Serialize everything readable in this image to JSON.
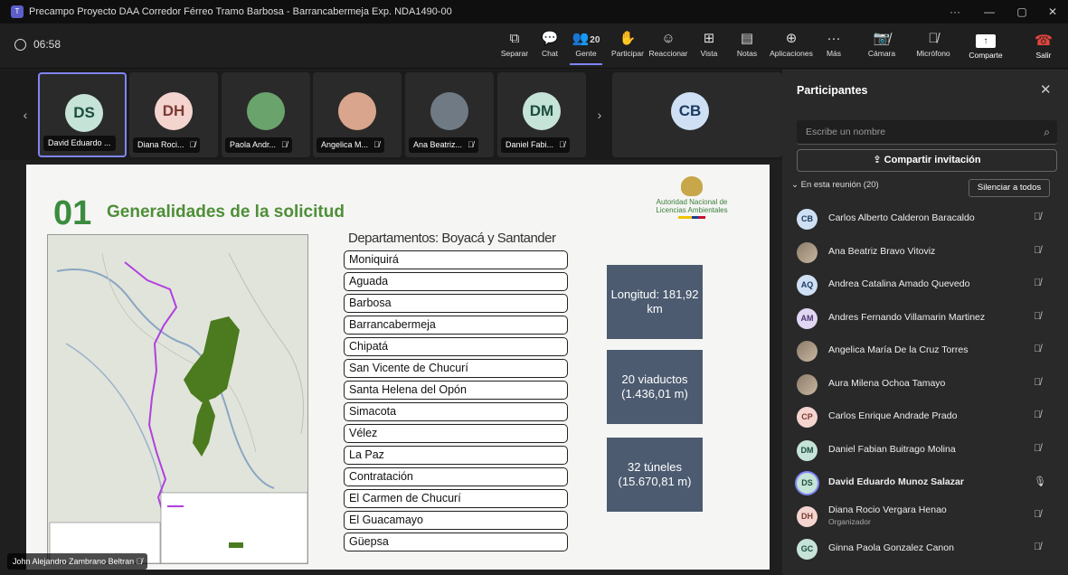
{
  "window": {
    "title": "Precampo Proyecto DAA Corredor Férreo Tramo Barbosa - Barrancabermeja Exp. NDA1490-00",
    "controls": [
      "···",
      "—",
      "▢",
      "✕"
    ]
  },
  "toolbar": {
    "timer": "06:58",
    "buttons": [
      {
        "id": "separar",
        "label": "Separar",
        "icon": "⧉"
      },
      {
        "id": "chat",
        "label": "Chat",
        "icon": "💬"
      },
      {
        "id": "gente",
        "label": "Gente",
        "icon": "👥",
        "count": "20"
      },
      {
        "id": "participar",
        "label": "Participar",
        "icon": "✋"
      },
      {
        "id": "reaccionar",
        "label": "Reaccionar",
        "icon": "☺"
      },
      {
        "id": "vista",
        "label": "Vista",
        "icon": "⊞"
      },
      {
        "id": "notas",
        "label": "Notas",
        "icon": "▤"
      },
      {
        "id": "aplicaciones",
        "label": "Aplicaciones",
        "icon": "⊕"
      },
      {
        "id": "mas",
        "label": "Más",
        "icon": "···"
      },
      {
        "id": "camara",
        "label": "Cámara",
        "icon": "📷̸"
      },
      {
        "id": "microfono",
        "label": "Micrófono",
        "icon": "🎙̸"
      }
    ],
    "compartir_label": "Comparte",
    "salir_label": "Salir"
  },
  "video_strip": [
    {
      "initials": "DS",
      "name": "David Eduardo ...",
      "color": "#c6e3d8",
      "text_color": "#1b4d3e",
      "muted": false
    },
    {
      "initials": "DH",
      "name": "Diana Roci...",
      "color": "#f4d4cf",
      "text_color": "#7a3b32",
      "muted": true
    },
    {
      "initials": "",
      "name": "Paola Andr...",
      "color": "#6aa36b",
      "text_color": "#fff",
      "muted": true
    },
    {
      "initials": "",
      "name": "Angelica M...",
      "color": "#d9a58d",
      "text_color": "#fff",
      "muted": true
    },
    {
      "initials": "",
      "name": "Ana Beatriz...",
      "color": "#6f7a84",
      "text_color": "#fff",
      "muted": true
    },
    {
      "initials": "DM",
      "name": "Daniel Fabi...",
      "color": "#c6e3d8",
      "text_color": "#1b4d3e",
      "muted": true
    },
    {
      "initials": "",
      "name": "",
      "color": "#2a2a2a",
      "text_color": "#fff",
      "muted": true
    },
    {
      "initials": "CB",
      "name": "",
      "color": "#cfe0f4",
      "text_color": "#1c3a60",
      "muted": false
    }
  ],
  "slide": {
    "number": "01",
    "title": "Generalidades de la solicitud",
    "logo_text": "Autoridad Nacional de Licencias Ambientales",
    "departments_header": "Departamentos: Boyacá y Santander",
    "municipalities": [
      "Moniquirá",
      "Aguada",
      "Barbosa",
      "Barrancabermeja",
      "Chipatá",
      "San Vicente de Chucurí",
      "Santa Helena del Opón",
      "Simacota",
      "Vélez",
      "La Paz",
      "Contratación",
      "El Carmen de Chucurí",
      "El Guacamayo",
      "Güepsa"
    ],
    "info_boxes": [
      "Longitud: 181,92 km",
      "20 viaductos (1.436,01 m)",
      "32 túneles (15.670,81 m)"
    ]
  },
  "presenter_label": "John Alejandro Zambrano Beltran",
  "panel": {
    "title": "Participantes",
    "search_placeholder": "Escribe un nombre",
    "invite_label": "Compartir invitación",
    "section_label": "En esta reunión (20)",
    "mute_all_label": "Silenciar a todos",
    "participants": [
      {
        "initials": "CB",
        "name": "Carlos Alberto Calderon Baracaldo",
        "color": "#cfe0f4",
        "text_color": "#1c3a60",
        "role": "",
        "mic": "muted"
      },
      {
        "initials": "",
        "name": "Ana Beatriz Bravo Vitoviz",
        "color": "#6f7a84",
        "text_color": "#fff",
        "role": "",
        "mic": "muted"
      },
      {
        "initials": "AQ",
        "name": "Andrea Catalina Amado Quevedo",
        "color": "#cfe0f4",
        "text_color": "#1c3a60",
        "role": "",
        "mic": "muted"
      },
      {
        "initials": "AM",
        "name": "Andres Fernando Villamarin Martinez",
        "color": "#e0d6f2",
        "text_color": "#4a3570",
        "role": "",
        "mic": "muted"
      },
      {
        "initials": "",
        "name": "Angelica María De la Cruz Torres",
        "color": "#d9a58d",
        "text_color": "#fff",
        "role": "",
        "mic": "muted"
      },
      {
        "initials": "",
        "name": "Aura Milena Ochoa Tamayo",
        "color": "#9a9a9a",
        "text_color": "#fff",
        "role": "",
        "mic": "muted"
      },
      {
        "initials": "CP",
        "name": "Carlos Enrique Andrade Prado",
        "color": "#f4d4cf",
        "text_color": "#7a3b32",
        "role": "",
        "mic": "muted"
      },
      {
        "initials": "DM",
        "name": "Daniel Fabian Buitrago Molina",
        "color": "#c6e3d8",
        "text_color": "#1b4d3e",
        "role": "",
        "mic": "muted"
      },
      {
        "initials": "DS",
        "name": "David Eduardo Munoz Salazar",
        "color": "#c6e3d8",
        "text_color": "#1b4d3e",
        "role": "",
        "mic": "on"
      },
      {
        "initials": "DH",
        "name": "Diana Rocio Vergara Henao",
        "color": "#f4d4cf",
        "text_color": "#7a3b32",
        "role": "Organizador",
        "mic": "muted"
      },
      {
        "initials": "GC",
        "name": "Ginna Paola Gonzalez Canon",
        "color": "#c6e3d8",
        "text_color": "#1b4d3e",
        "role": "",
        "mic": "muted"
      }
    ]
  }
}
